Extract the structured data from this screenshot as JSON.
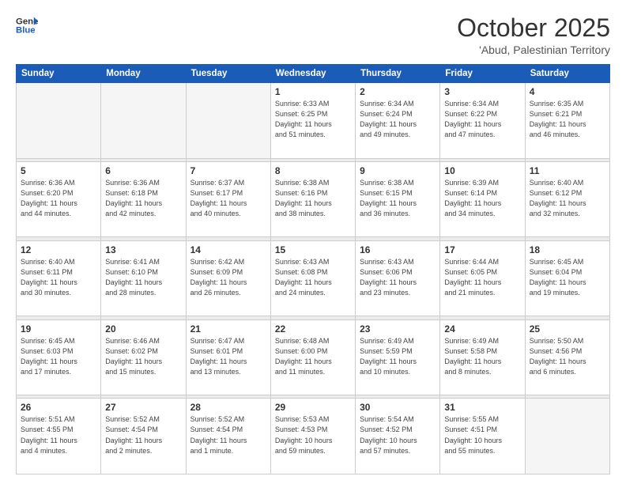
{
  "logo": {
    "line1": "General",
    "line2": "Blue"
  },
  "header": {
    "month": "October 2025",
    "location": "'Abud, Palestinian Territory"
  },
  "weekdays": [
    "Sunday",
    "Monday",
    "Tuesday",
    "Wednesday",
    "Thursday",
    "Friday",
    "Saturday"
  ],
  "weeks": [
    [
      {
        "day": "",
        "info": ""
      },
      {
        "day": "",
        "info": ""
      },
      {
        "day": "",
        "info": ""
      },
      {
        "day": "1",
        "info": "Sunrise: 6:33 AM\nSunset: 6:25 PM\nDaylight: 11 hours\nand 51 minutes."
      },
      {
        "day": "2",
        "info": "Sunrise: 6:34 AM\nSunset: 6:24 PM\nDaylight: 11 hours\nand 49 minutes."
      },
      {
        "day": "3",
        "info": "Sunrise: 6:34 AM\nSunset: 6:22 PM\nDaylight: 11 hours\nand 47 minutes."
      },
      {
        "day": "4",
        "info": "Sunrise: 6:35 AM\nSunset: 6:21 PM\nDaylight: 11 hours\nand 46 minutes."
      }
    ],
    [
      {
        "day": "5",
        "info": "Sunrise: 6:36 AM\nSunset: 6:20 PM\nDaylight: 11 hours\nand 44 minutes."
      },
      {
        "day": "6",
        "info": "Sunrise: 6:36 AM\nSunset: 6:18 PM\nDaylight: 11 hours\nand 42 minutes."
      },
      {
        "day": "7",
        "info": "Sunrise: 6:37 AM\nSunset: 6:17 PM\nDaylight: 11 hours\nand 40 minutes."
      },
      {
        "day": "8",
        "info": "Sunrise: 6:38 AM\nSunset: 6:16 PM\nDaylight: 11 hours\nand 38 minutes."
      },
      {
        "day": "9",
        "info": "Sunrise: 6:38 AM\nSunset: 6:15 PM\nDaylight: 11 hours\nand 36 minutes."
      },
      {
        "day": "10",
        "info": "Sunrise: 6:39 AM\nSunset: 6:14 PM\nDaylight: 11 hours\nand 34 minutes."
      },
      {
        "day": "11",
        "info": "Sunrise: 6:40 AM\nSunset: 6:12 PM\nDaylight: 11 hours\nand 32 minutes."
      }
    ],
    [
      {
        "day": "12",
        "info": "Sunrise: 6:40 AM\nSunset: 6:11 PM\nDaylight: 11 hours\nand 30 minutes."
      },
      {
        "day": "13",
        "info": "Sunrise: 6:41 AM\nSunset: 6:10 PM\nDaylight: 11 hours\nand 28 minutes."
      },
      {
        "day": "14",
        "info": "Sunrise: 6:42 AM\nSunset: 6:09 PM\nDaylight: 11 hours\nand 26 minutes."
      },
      {
        "day": "15",
        "info": "Sunrise: 6:43 AM\nSunset: 6:08 PM\nDaylight: 11 hours\nand 24 minutes."
      },
      {
        "day": "16",
        "info": "Sunrise: 6:43 AM\nSunset: 6:06 PM\nDaylight: 11 hours\nand 23 minutes."
      },
      {
        "day": "17",
        "info": "Sunrise: 6:44 AM\nSunset: 6:05 PM\nDaylight: 11 hours\nand 21 minutes."
      },
      {
        "day": "18",
        "info": "Sunrise: 6:45 AM\nSunset: 6:04 PM\nDaylight: 11 hours\nand 19 minutes."
      }
    ],
    [
      {
        "day": "19",
        "info": "Sunrise: 6:45 AM\nSunset: 6:03 PM\nDaylight: 11 hours\nand 17 minutes."
      },
      {
        "day": "20",
        "info": "Sunrise: 6:46 AM\nSunset: 6:02 PM\nDaylight: 11 hours\nand 15 minutes."
      },
      {
        "day": "21",
        "info": "Sunrise: 6:47 AM\nSunset: 6:01 PM\nDaylight: 11 hours\nand 13 minutes."
      },
      {
        "day": "22",
        "info": "Sunrise: 6:48 AM\nSunset: 6:00 PM\nDaylight: 11 hours\nand 11 minutes."
      },
      {
        "day": "23",
        "info": "Sunrise: 6:49 AM\nSunset: 5:59 PM\nDaylight: 11 hours\nand 10 minutes."
      },
      {
        "day": "24",
        "info": "Sunrise: 6:49 AM\nSunset: 5:58 PM\nDaylight: 11 hours\nand 8 minutes."
      },
      {
        "day": "25",
        "info": "Sunrise: 5:50 AM\nSunset: 4:56 PM\nDaylight: 11 hours\nand 6 minutes."
      }
    ],
    [
      {
        "day": "26",
        "info": "Sunrise: 5:51 AM\nSunset: 4:55 PM\nDaylight: 11 hours\nand 4 minutes."
      },
      {
        "day": "27",
        "info": "Sunrise: 5:52 AM\nSunset: 4:54 PM\nDaylight: 11 hours\nand 2 minutes."
      },
      {
        "day": "28",
        "info": "Sunrise: 5:52 AM\nSunset: 4:54 PM\nDaylight: 11 hours\nand 1 minute."
      },
      {
        "day": "29",
        "info": "Sunrise: 5:53 AM\nSunset: 4:53 PM\nDaylight: 10 hours\nand 59 minutes."
      },
      {
        "day": "30",
        "info": "Sunrise: 5:54 AM\nSunset: 4:52 PM\nDaylight: 10 hours\nand 57 minutes."
      },
      {
        "day": "31",
        "info": "Sunrise: 5:55 AM\nSunset: 4:51 PM\nDaylight: 10 hours\nand 55 minutes."
      },
      {
        "day": "",
        "info": ""
      }
    ]
  ]
}
